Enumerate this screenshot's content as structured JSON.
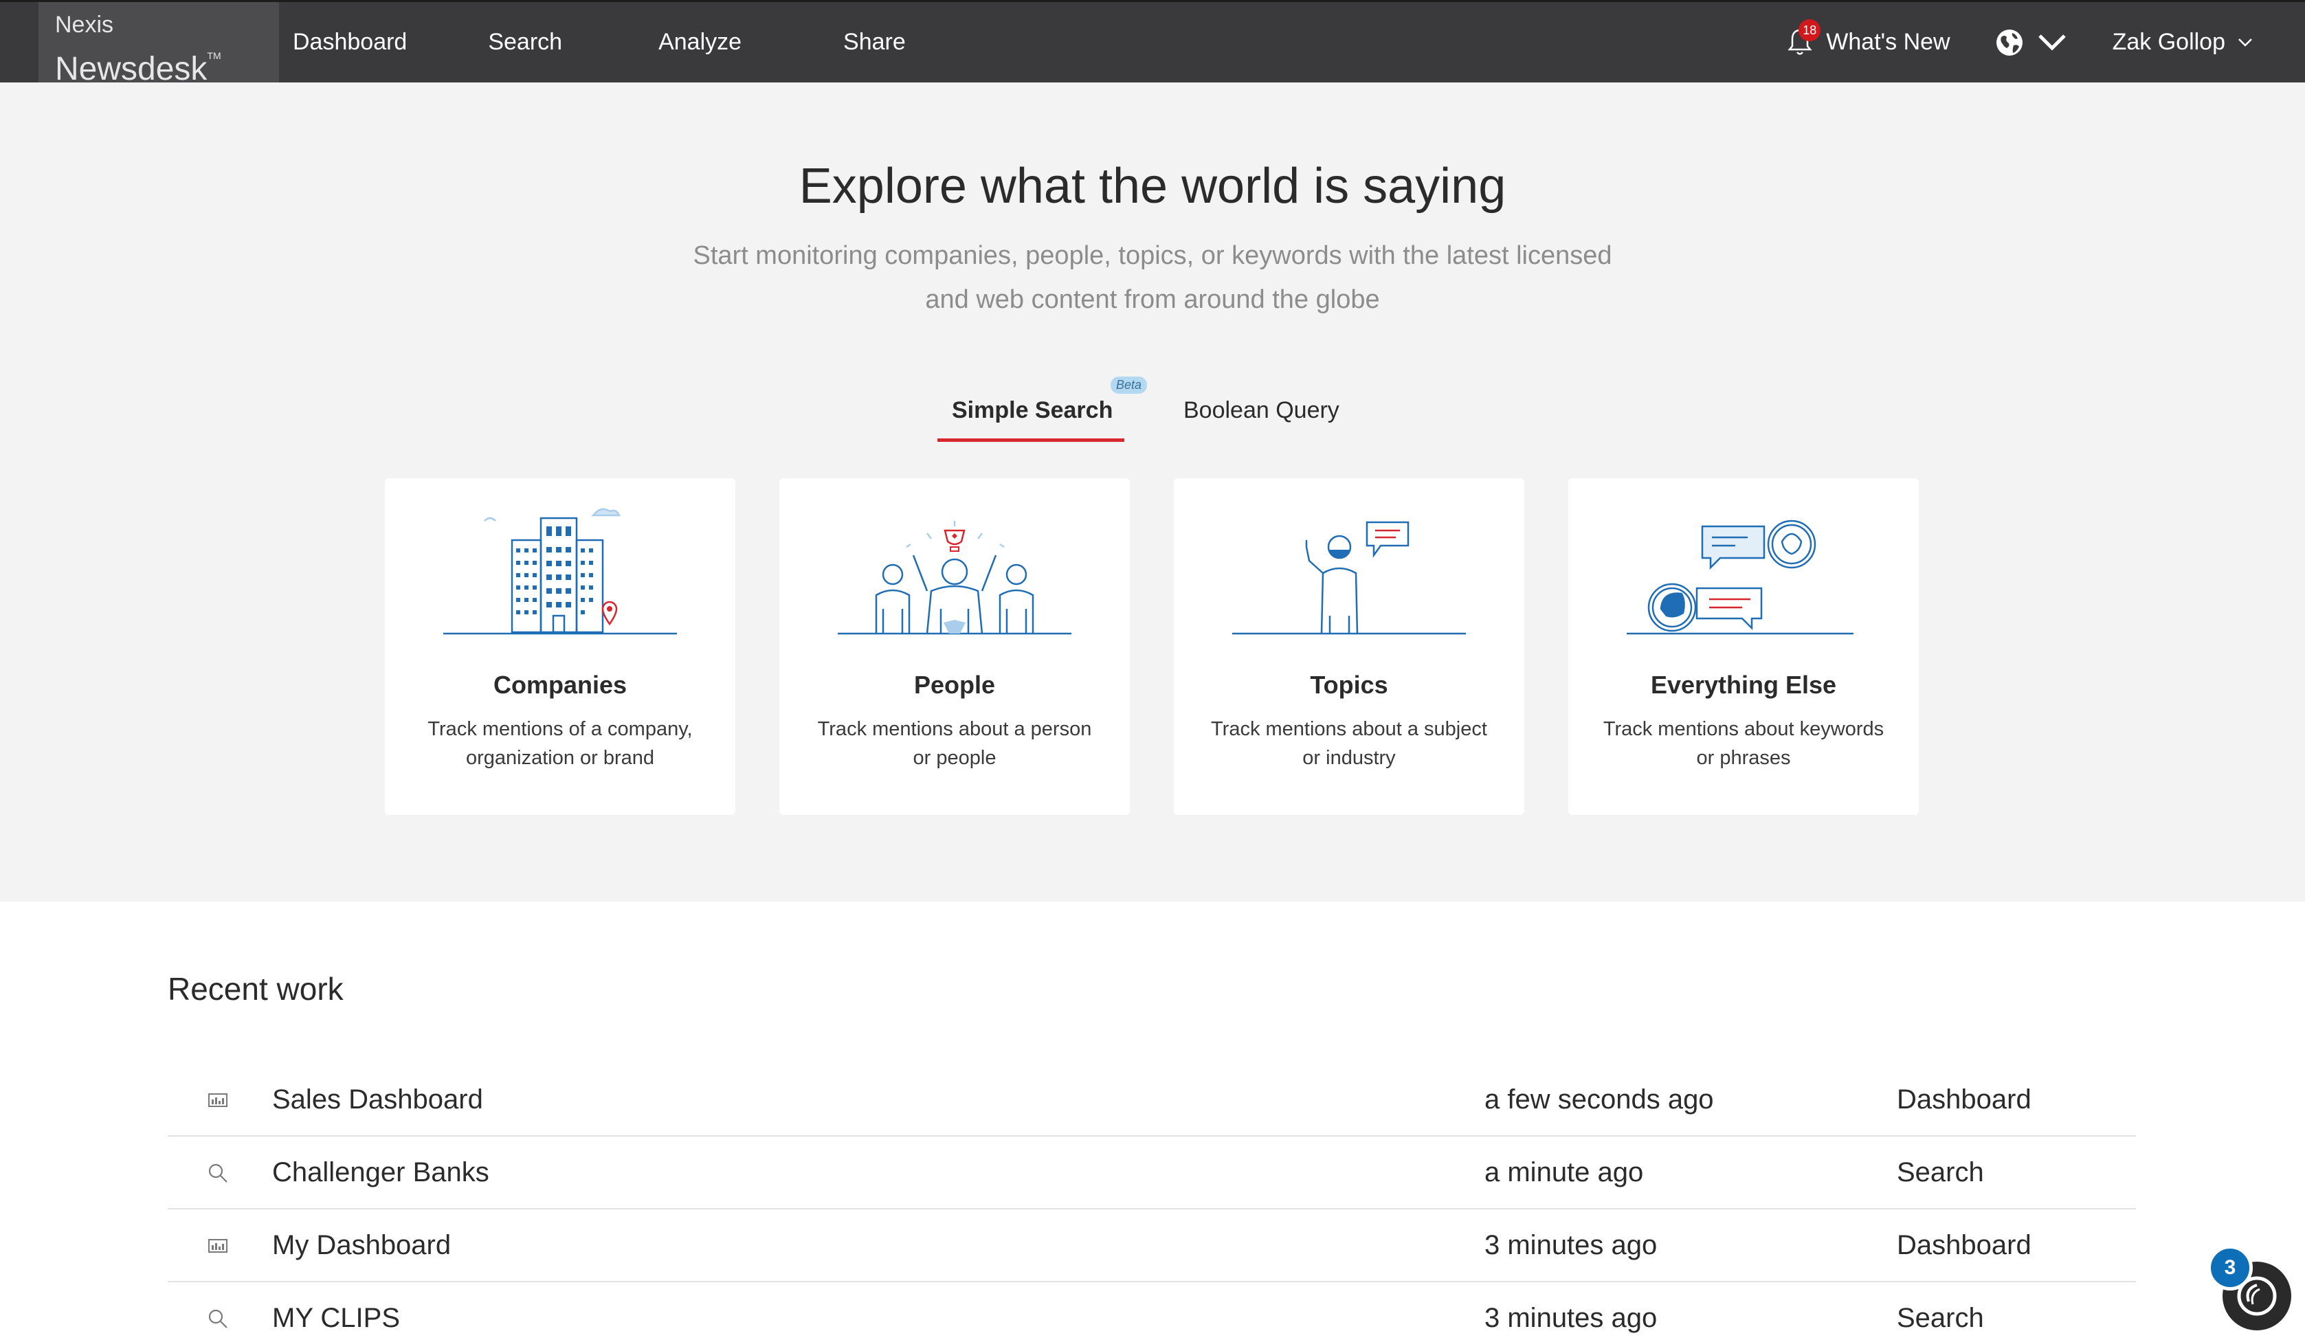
{
  "nav": {
    "brand_line1": "Nexis",
    "brand_line2": "Newsdesk",
    "brand_tm": "TM",
    "links": [
      "Dashboard",
      "Search",
      "Analyze",
      "Share"
    ],
    "notification_count": "18",
    "whats_new": "What's New",
    "user_name": "Zak Gollop"
  },
  "hero": {
    "title": "Explore what the world is saying",
    "subtitle": "Start monitoring companies, people, topics, or keywords with the latest licensed and web content from around the globe",
    "tabs": [
      {
        "label": "Simple Search",
        "badge": "Beta",
        "active": true
      },
      {
        "label": "Boolean Query",
        "active": false
      }
    ],
    "cards": [
      {
        "title": "Companies",
        "description": "Track mentions of a company, organization or brand",
        "icon": "building-illustration"
      },
      {
        "title": "People",
        "description": "Track mentions about a person or people",
        "icon": "people-celebrating-illustration"
      },
      {
        "title": "Topics",
        "description": "Track mentions about a subject or industry",
        "icon": "person-speech-bubble-illustration"
      },
      {
        "title": "Everything Else",
        "description": "Track mentions about keywords or phrases",
        "icon": "conversation-illustration"
      }
    ]
  },
  "recent": {
    "title": "Recent work",
    "items": [
      {
        "name": "Sales Dashboard",
        "time": "a few seconds ago",
        "type": "Dashboard",
        "icon": "dashboard-icon"
      },
      {
        "name": "Challenger Banks",
        "time": "a minute ago",
        "type": "Search",
        "icon": "search-icon"
      },
      {
        "name": "My Dashboard",
        "time": "3 minutes ago",
        "type": "Dashboard",
        "icon": "dashboard-icon"
      },
      {
        "name": "MY CLIPS",
        "time": "3 minutes ago",
        "type": "Search",
        "icon": "search-icon"
      }
    ]
  },
  "help_widget": {
    "badge_count": "3"
  },
  "colors": {
    "nav_bg": "#3a3a3c",
    "hero_bg": "#f3f3f3",
    "accent_red": "#d7262e",
    "illustration_blue": "#1f6db5",
    "help_badge_blue": "#0d6fb8"
  }
}
